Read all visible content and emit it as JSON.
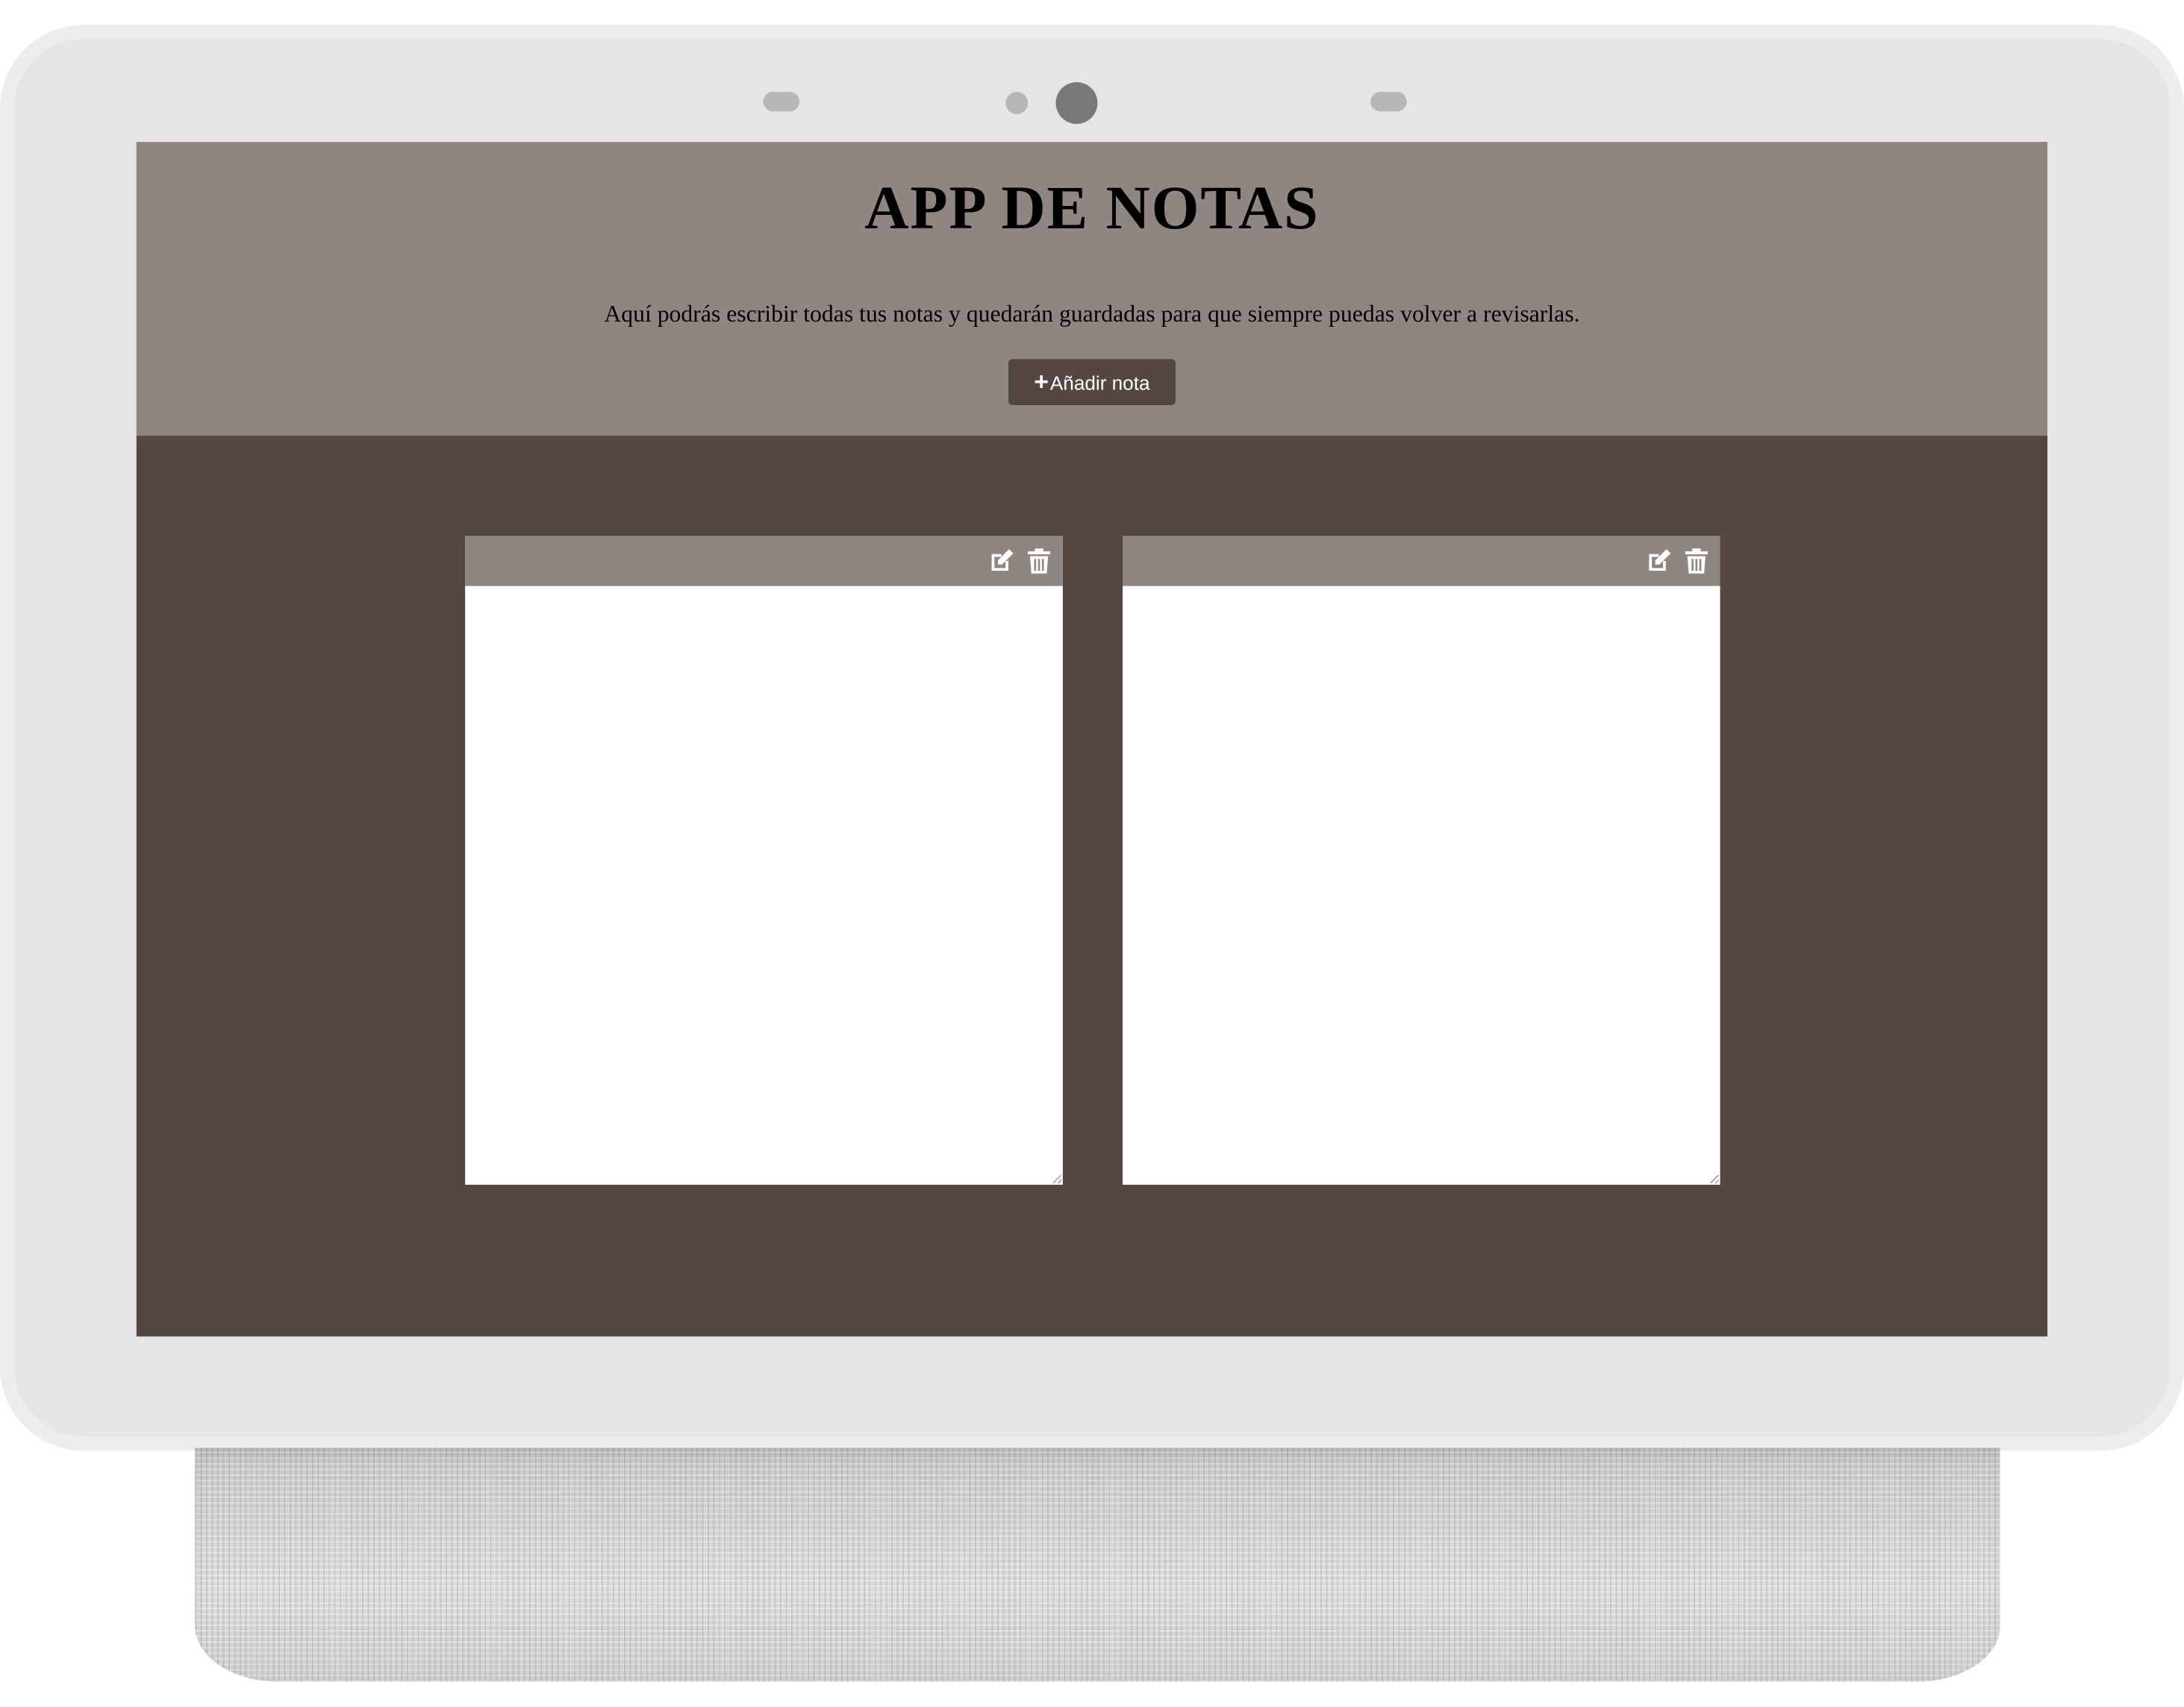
{
  "app": {
    "title": "APP DE NOTAS",
    "description": "Aquí podrás escribir todas tus notas y quedarán guardadas para que siempre puedas volver a revisarlas.",
    "add_button_icon": "+",
    "add_button_label": "Añadir nota"
  },
  "notes": [
    {
      "text": "",
      "edit_icon": "edit-icon",
      "delete_icon": "trash-icon"
    },
    {
      "text": "",
      "edit_icon": "edit-icon",
      "delete_icon": "trash-icon"
    }
  ],
  "colors": {
    "header_bg": "#8f8682",
    "page_bg": "#544640",
    "button_bg": "#544640",
    "note_bg": "#ffffff",
    "device_frame": "#e6e5e4"
  }
}
